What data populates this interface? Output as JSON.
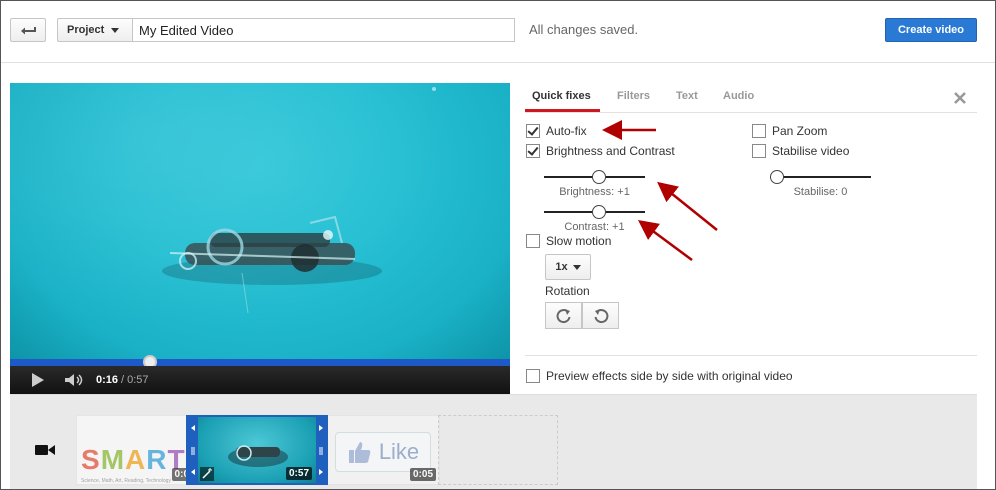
{
  "header": {
    "project_label": "Project",
    "title_value": "My Edited Video",
    "save_status": "All changes saved.",
    "create_label": "Create video"
  },
  "player": {
    "time_current": "0:16",
    "time_separator": "/",
    "time_total": "0:57",
    "progress_fraction": 0.28
  },
  "panel": {
    "tabs": [
      {
        "label": "Quick fixes",
        "active": true
      },
      {
        "label": "Filters",
        "active": false
      },
      {
        "label": "Text",
        "active": false
      },
      {
        "label": "Audio",
        "active": false
      }
    ],
    "options": {
      "autofix": {
        "label": "Auto-fix",
        "checked": true
      },
      "brightness_contrast": {
        "label": "Brightness and Contrast",
        "checked": true
      },
      "slow_motion": {
        "label": "Slow motion",
        "checked": false
      },
      "pan_zoom": {
        "label": "Pan Zoom",
        "checked": false
      },
      "stabilise": {
        "label": "Stabilise video",
        "checked": false
      }
    },
    "sliders": {
      "brightness_label": "Brightness: +1",
      "contrast_label": "Contrast: +1",
      "stabilise_label": "Stabilise: 0"
    },
    "speed_value": "1x",
    "rotation_label": "Rotation",
    "preview_label": "Preview effects side by side with original video"
  },
  "timeline": {
    "clips": [
      {
        "duration": "0:0",
        "brand_text": "SMART",
        "brand_sub": "Science, Math, Art, Reading, Technology"
      },
      {
        "duration": "0:57"
      },
      {
        "duration": "0:05",
        "like_text": "Like"
      }
    ]
  },
  "colors": {
    "accent_blue": "#2a7ad5",
    "tab_red": "#cc181e",
    "annotation_red": "#b00000"
  }
}
